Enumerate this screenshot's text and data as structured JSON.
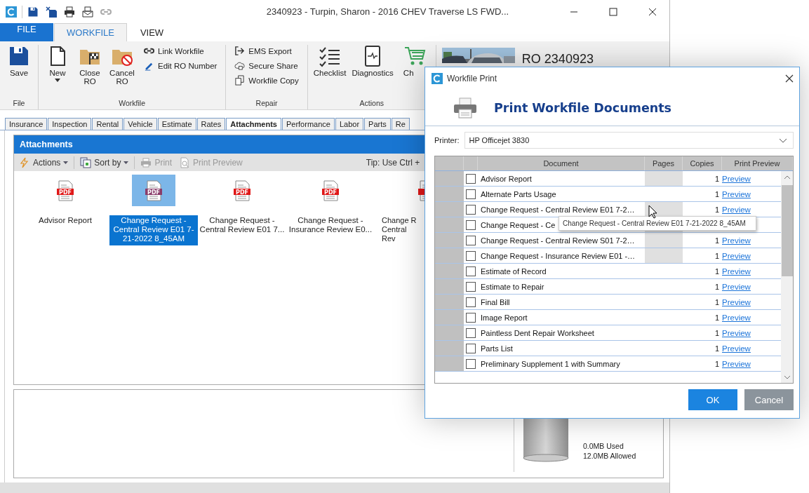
{
  "window": {
    "title": "2340923 - Turpin, Sharon - 2016 CHEV Traverse LS FWD..."
  },
  "ribbon_tabs": [
    {
      "label": "FILE",
      "kind": "file",
      "selected": false
    },
    {
      "label": "WORKFILE",
      "kind": "tab",
      "selected": true
    },
    {
      "label": "VIEW",
      "kind": "tab",
      "selected": false
    }
  ],
  "ribbon_groups": [
    {
      "label": "File",
      "large": [
        {
          "label": "Save",
          "dropdown": false
        }
      ]
    },
    {
      "label": "Workfile",
      "large": [
        {
          "label": "New",
          "dropdown": true
        },
        {
          "label": "Close RO",
          "dropdown": false
        },
        {
          "label": "Cancel RO",
          "dropdown": false
        }
      ],
      "small": [
        "Link Workfile",
        "Edit RO Number"
      ]
    },
    {
      "label": "Repair",
      "small": [
        "EMS Export",
        "Secure Share",
        "Workfile Copy"
      ]
    },
    {
      "label": "Actions",
      "large": [
        {
          "label": "Checklist",
          "dropdown": false
        },
        {
          "label": "Diagnostics",
          "dropdown": false
        },
        {
          "label": "Ch",
          "dropdown": false
        }
      ]
    }
  ],
  "vehicle": {
    "ro": "RO 2340923"
  },
  "doc_tabs": [
    {
      "label": "Insurance",
      "selected": false
    },
    {
      "label": "Inspection",
      "selected": false
    },
    {
      "label": "Rental",
      "selected": false
    },
    {
      "label": "Vehicle",
      "selected": false
    },
    {
      "label": "Estimate",
      "selected": false
    },
    {
      "label": "Rates",
      "selected": false
    },
    {
      "label": "Attachments",
      "selected": true
    },
    {
      "label": "Performance",
      "selected": false
    },
    {
      "label": "Labor",
      "selected": false
    },
    {
      "label": "Parts",
      "selected": false
    },
    {
      "label": "Re",
      "selected": false
    }
  ],
  "attachments": {
    "title": "Attachments",
    "toolbar": [
      {
        "label": "Actions",
        "dropdown": true,
        "disabled": false
      },
      {
        "label": "Sort by",
        "dropdown": true,
        "disabled": false
      },
      {
        "label": "Print",
        "dropdown": false,
        "disabled": true
      },
      {
        "label": "Print Preview",
        "dropdown": false,
        "disabled": true
      }
    ],
    "tip": "Tip: Use Ctrl +",
    "files": [
      {
        "label": "Advisor Report",
        "badge": "PDF",
        "selected": false
      },
      {
        "label": "Change Request - Central Review E01 7-21-2022 8_45AM",
        "badge": "PDF",
        "selected": true
      },
      {
        "label": "Change Request - Central Review E01 7...",
        "badge": "PDF",
        "selected": false
      },
      {
        "label": "Change Request - Insurance Review E0...",
        "badge": "PDF",
        "selected": false
      },
      {
        "label": "Change R Central Rev",
        "selected": false
      }
    ]
  },
  "storage": {
    "used": "0.0MB Used",
    "allowed": "12.0MB Allowed"
  },
  "dialog": {
    "title": "Workfile Print",
    "heading": "Print Workfile Documents",
    "printer_label": "Printer:",
    "printer": "HP Officejet 3830",
    "columns": [
      "Document",
      "Pages",
      "Copies",
      "Print Preview"
    ],
    "rows": [
      {
        "checked": false,
        "document": "Advisor Report",
        "pages_disabled": true,
        "copies": "1",
        "preview": "Preview"
      },
      {
        "checked": false,
        "document": "Alternate Parts Usage",
        "pages_disabled": false,
        "copies": "1",
        "preview": "Preview"
      },
      {
        "checked": false,
        "document": "Change Request - Central Review E01 7-2…",
        "pages_disabled": true,
        "copies": "1",
        "preview": "Preview"
      },
      {
        "checked": false,
        "document": "Change Request - Ce",
        "pages_disabled": true
      },
      {
        "checked": false,
        "document": "Change Request - Central Review S01 7-2…",
        "pages_disabled": true,
        "copies": "1",
        "preview": "Preview"
      },
      {
        "checked": false,
        "document": "Change Request - Insurance Review E01 -…",
        "pages_disabled": true,
        "copies": "1",
        "preview": "Preview"
      },
      {
        "checked": false,
        "document": "Estimate of Record",
        "pages_disabled": false,
        "copies": "1",
        "preview": "Preview"
      },
      {
        "checked": false,
        "document": "Estimate to Repair",
        "pages_disabled": false,
        "copies": "1",
        "preview": "Preview"
      },
      {
        "checked": false,
        "document": "Final Bill",
        "pages_disabled": false,
        "copies": "1",
        "preview": "Preview"
      },
      {
        "checked": false,
        "document": "Image Report",
        "pages_disabled": false,
        "copies": "1",
        "preview": "Preview"
      },
      {
        "checked": false,
        "document": "Paintless Dent Repair Worksheet",
        "pages_disabled": false,
        "copies": "1",
        "preview": "Preview"
      },
      {
        "checked": false,
        "document": "Parts List",
        "pages_disabled": false,
        "copies": "1",
        "preview": "Preview"
      },
      {
        "checked": false,
        "document": "Preliminary Supplement 1 with Summary",
        "pages_disabled": false,
        "copies": "1",
        "preview": "Preview"
      }
    ],
    "tooltip": "Change Request - Central Review E01 7-21-2022 8_45AM",
    "buttons": [
      {
        "label": "OK",
        "kind": "primary"
      },
      {
        "label": "Cancel",
        "kind": "secondary"
      }
    ]
  }
}
